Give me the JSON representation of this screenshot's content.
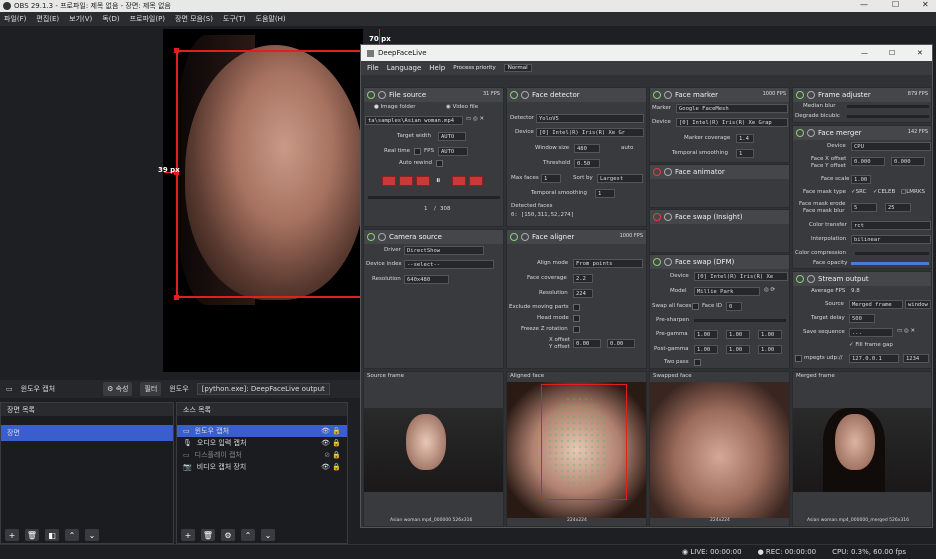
{
  "obs": {
    "title": "OBS 29.1.3 - 프로파일: 제목 없음 - 장면: 제목 없음",
    "menu": [
      "파일(F)",
      "편집(E)",
      "보기(V)",
      "독(D)",
      "프로파일(P)",
      "장면 모음(S)",
      "도구(T)",
      "도움말(H)"
    ],
    "annot_top": "70 px",
    "annot_left": "39 px",
    "toolbar": {
      "source": "윈도우 캡처",
      "props": "속성",
      "filter": "필터",
      "win_label": "윈도우",
      "win_value": "[python.exe]: DeepFaceLive output"
    },
    "scenes_title": "장면 목록",
    "scene": "장면",
    "sources_title": "소스 목록",
    "sources": [
      "윈도우 캡처",
      "오디오 입력 캡처",
      "디스플레이 캡처",
      "비디오 캡처 장치"
    ],
    "status": {
      "live": "LIVE: 00:00:00",
      "rec": "REC: 00:00:00",
      "cpu": "CPU: 0.3%, 60.00 fps"
    }
  },
  "dfl": {
    "title": "DeepFaceLive",
    "menu": [
      "File",
      "Language",
      "Help"
    ],
    "process_label": "Process priority",
    "process_value": "Normal",
    "file_source": {
      "title": "File source",
      "fps": "31 FPS",
      "image_folder": "Image folder",
      "video_file": "Video file",
      "path": "ta\\samples\\Asian woman.mp4",
      "target_width_label": "Target width",
      "target_width": "AUTO",
      "realtime_label": "Real time",
      "fps_label": "FPS",
      "fps_value": "AUTO",
      "autorewind": "Auto rewind",
      "frame": "1",
      "total": "308"
    },
    "camera_source": {
      "title": "Camera source",
      "driver_label": "Driver",
      "driver": "DirectShow",
      "device_label": "Device index",
      "device": "--select--",
      "res_label": "Resolution",
      "res": "640x480"
    },
    "face_detector": {
      "title": "Face detector",
      "detector_label": "Detector",
      "detector": "YoloV5",
      "device_label": "Device",
      "device": "[0] Intel(R) Iris(R) Xe Gr",
      "window_label": "Window size",
      "window": "480",
      "auto": "auto",
      "threshold_label": "Threshold",
      "threshold": "0.50",
      "maxfaces_label": "Max faces",
      "maxfaces": "1",
      "sortby_label": "Sort by",
      "sortby": "Largest",
      "temporal_label": "Temporal smoothing",
      "temporal": "1",
      "detected_label": "Detected faces",
      "detected": "0: [150,311,52,274]"
    },
    "face_aligner": {
      "title": "Face aligner",
      "fps": "1000 FPS",
      "align_label": "Align mode",
      "align": "From points",
      "coverage_label": "Face coverage",
      "coverage": "2.2",
      "res_label": "Resolution",
      "res": "224",
      "exclude": "Exclude moving parts",
      "head": "Head mode",
      "freeze": "Freeze Z rotation",
      "xoff": "X offset",
      "yoff": "Y offset",
      "xv": "0.00",
      "yv": "0.00"
    },
    "face_marker": {
      "title": "Face marker",
      "fps": "1000 FPS",
      "marker_label": "Marker",
      "marker": "Google FaceMesh",
      "device_label": "Device",
      "device": "[0] Intel(R) Iris(R) Xe Grap",
      "coverage_label": "Marker coverage",
      "coverage": "1.4",
      "temporal_label": "Temporal smoothing",
      "temporal": "1"
    },
    "face_animator": {
      "title": "Face animator"
    },
    "face_swap_insight": {
      "title": "Face swap (Insight)"
    },
    "face_swap_dfm": {
      "title": "Face swap (DFM)",
      "device_label": "Device",
      "device": "[0] Intel(R) Iris(R) Xe",
      "model_label": "Model",
      "model": "Millie Park",
      "swapall": "Swap all faces",
      "faceid_label": "Face ID",
      "faceid": "0",
      "presharpen": "Pre-sharpen",
      "pregamma": "Pre-gamma",
      "postgamma": "Post-gamma",
      "gamma": "1.00",
      "twopass": "Two pass"
    },
    "frame_adjuster": {
      "title": "Frame adjuster",
      "fps": "879 FPS",
      "median": "Median blur",
      "degrade": "Degrade bicubic"
    },
    "face_merger": {
      "title": "Face merger",
      "fps": "142 FPS",
      "device_label": "Device",
      "device": "CPU",
      "xoff": "Face X offset",
      "yoff": "Face Y offset",
      "off": "0.000",
      "scale_label": "Face scale",
      "scale": "1.00",
      "mask_label": "Face mask type",
      "src": "SRC",
      "celeb": "CELEB",
      "lmrks": "LMRKS",
      "erode_label": "Face mask erode",
      "blur_label": "Face mask blur",
      "erode": "5",
      "blur": "25",
      "color_label": "Color transfer",
      "color": "rct",
      "interp_label": "Interpolation",
      "interp": "bilinear",
      "compress_label": "Color compression",
      "opacity_label": "Face opacity"
    },
    "stream_output": {
      "title": "Stream output",
      "avgfps_label": "Average FPS",
      "avgfps": "9.8",
      "source_label": "Source",
      "source": "Merged frame",
      "window": "window",
      "delay_label": "Target delay",
      "delay": "500",
      "seq_label": "Save sequence",
      "seq": "...",
      "fillgap": "Fill frame gap",
      "mpegts": "mpegts udp://",
      "ip": "127.0.0.1",
      "port": "1234"
    },
    "frames": {
      "source": "Source frame",
      "aligned": "Aligned face",
      "swapped": "Swapped face",
      "merged": "Merged frame",
      "source_cap": "Asian woman.mp4_000000 526x316",
      "aligned_cap": "224x224",
      "swapped_cap": "224x224",
      "merged_cap": "Asian woman.mp4_000000_merged 526x316"
    }
  }
}
